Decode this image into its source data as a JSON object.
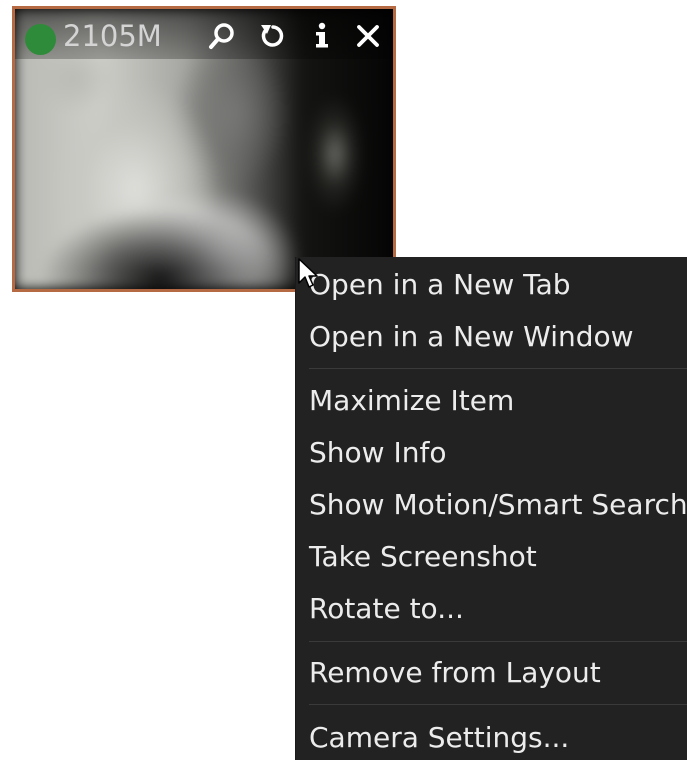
{
  "camera_tile": {
    "status": "online",
    "status_color": "#2e8b3a",
    "bitrate": "2105M",
    "border_color": "#b66a44",
    "buttons": [
      {
        "icon": "search-icon",
        "symbol": "zoom"
      },
      {
        "icon": "rotate-icon",
        "symbol": "rotate"
      },
      {
        "icon": "info-icon",
        "symbol": "info"
      },
      {
        "icon": "close-icon",
        "symbol": "close"
      }
    ]
  },
  "context_menu": {
    "items": [
      {
        "label": "Open in a New Tab"
      },
      {
        "label": "Open in a New Window"
      },
      {
        "label": "Maximize Item"
      },
      {
        "label": "Show Info"
      },
      {
        "label": "Show Motion/Smart Search"
      },
      {
        "label": "Take Screenshot"
      },
      {
        "label": "Rotate to..."
      },
      {
        "label": "Remove from Layout"
      },
      {
        "label": "Camera Settings..."
      }
    ]
  }
}
